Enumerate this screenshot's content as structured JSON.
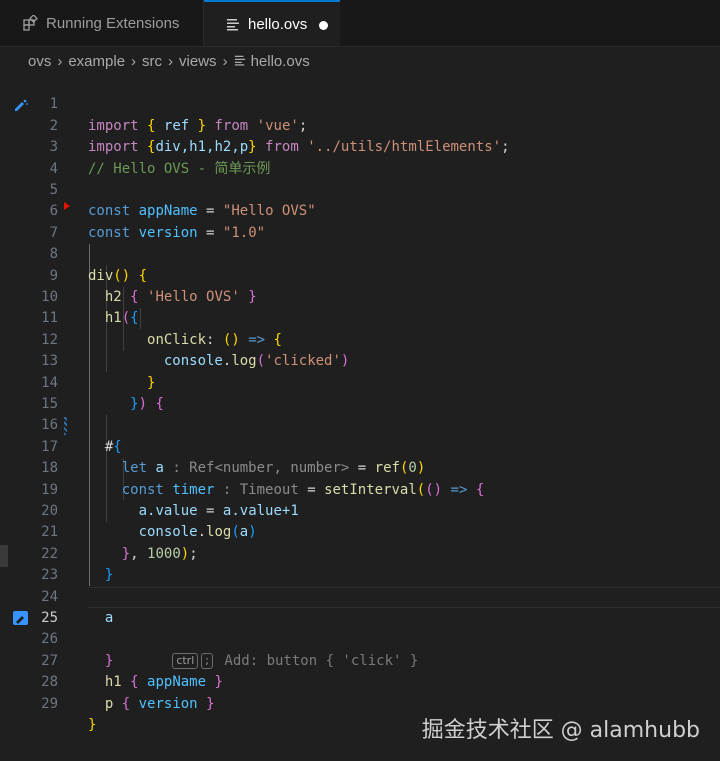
{
  "tabs": [
    {
      "label": "Running Extensions",
      "icon": "extensions-icon",
      "active": false
    },
    {
      "label": "hello.ovs",
      "icon": "file-lines-icon",
      "active": true,
      "dirty": true
    }
  ],
  "breadcrumb": [
    "ovs",
    "example",
    "src",
    "views",
    "hello.ovs"
  ],
  "editor": {
    "line_numbers": [
      "1",
      "2",
      "3",
      "4",
      "5",
      "6",
      "7",
      "8",
      "9",
      "10",
      "11",
      "12",
      "13",
      "14",
      "15",
      "16",
      "17",
      "18",
      "19",
      "20",
      "21",
      "22",
      "23",
      "24",
      "25",
      "26",
      "27",
      "28",
      "29"
    ],
    "current_line": "25",
    "code": {
      "l1": {
        "a": "import",
        "b": "{",
        "c": "ref",
        "d": "}",
        "e": "from",
        "f": "'vue'",
        "g": ";"
      },
      "l2": {
        "a": "import",
        "b": "{",
        "c": "div,h1,h2,p",
        "d": "}",
        "e": "from",
        "f": "'../utils/htmlElements'",
        "g": ";"
      },
      "l3": {
        "a": "// Hello OVS - 简单示例"
      },
      "l5": {
        "a": "const",
        "b": "appName",
        "c": "=",
        "d": "\"Hello OVS\""
      },
      "l6": {
        "a": "const",
        "b": "version",
        "c": "=",
        "d": "\"1.0\""
      },
      "l8": {
        "a": "div",
        "b": "()",
        "c": "{"
      },
      "l9": {
        "a": "h2",
        "b": "{",
        "c": "'Hello OVS'",
        "d": "}"
      },
      "l10": {
        "a": "h1",
        "b": "(",
        "c": "{"
      },
      "l11": {
        "a": "onClick",
        "b": ":",
        "c": "()",
        "d": "=>",
        "e": "{"
      },
      "l12": {
        "a": "console",
        "b": ".",
        "c": "log",
        "d": "(",
        "e": "'clicked'",
        "f": ")"
      },
      "l13": {
        "a": "}"
      },
      "l14": {
        "a": "}",
        "b": ")",
        "c": "{"
      },
      "l16": {
        "a": "#",
        "b": "{"
      },
      "l17": {
        "a": "let",
        "b": "a",
        "c": " : Ref<number, number>",
        "d": "=",
        "e": "ref",
        "f": "(",
        "g": "0",
        "h": ")"
      },
      "l18": {
        "a": "const",
        "b": "timer",
        "c": " : Timeout",
        "d": "=",
        "e": "setInterval",
        "f": "(",
        "g": "()",
        "h": "=>",
        "i": "{"
      },
      "l19": {
        "a": "a",
        "b": ".value",
        "c": "=",
        "d": "a",
        "e": ".value+1"
      },
      "l20": {
        "a": "console",
        "b": ".",
        "c": "log",
        "d": "(",
        "e": "a",
        "f": ")"
      },
      "l21": {
        "a": "}",
        "b": ",",
        "c": "1000",
        "d": ")",
        "e": ";"
      },
      "l22": {
        "a": "}"
      },
      "l24": {
        "a": "a"
      },
      "l26": {
        "a": "}",
        "k1": "ctrl",
        "k2": ";",
        "hint": "Add: button { 'click' }"
      },
      "l27": {
        "a": "h1",
        "b": "{",
        "c": "appName",
        "d": "}"
      },
      "l28": {
        "a": "p",
        "b": "{",
        "c": "version",
        "d": "}"
      },
      "l29": {
        "a": "}"
      }
    }
  },
  "watermark": "掘金技术社区 @ alamhubb",
  "colors": {
    "accent": "#0078d4",
    "background": "#1f1f1f"
  }
}
